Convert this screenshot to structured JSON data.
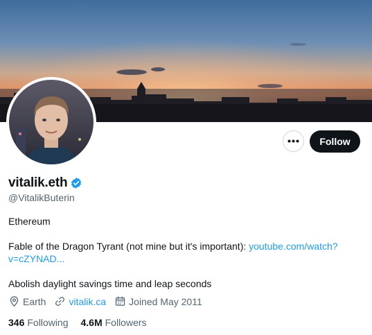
{
  "profile": {
    "display_name": "vitalik.eth",
    "handle": "@VitalikButerin",
    "verified": true
  },
  "actions": {
    "more_icon": "more-horizontal-icon",
    "follow_label": "Follow"
  },
  "bio": {
    "line1": "Ethereum",
    "line2_text": "Fable of the Dragon Tyrant (not mine but it's important): ",
    "line2_link": "youtube.com/watch?v=cZYNAD...",
    "line3": "Abolish daylight savings time and leap seconds"
  },
  "meta": {
    "location": "Earth",
    "website": "vitalik.ca",
    "joined": "Joined May 2011",
    "location_icon": "location-pin-icon",
    "website_icon": "link-icon",
    "joined_icon": "calendar-icon"
  },
  "stats": {
    "following_count": "346",
    "following_label": "Following",
    "followers_count": "4.6M",
    "followers_label": "Followers"
  },
  "colors": {
    "accent": "#1d9bf0",
    "text_primary": "#0f1419",
    "text_secondary": "#536471",
    "follow_bg": "#0f1419"
  }
}
